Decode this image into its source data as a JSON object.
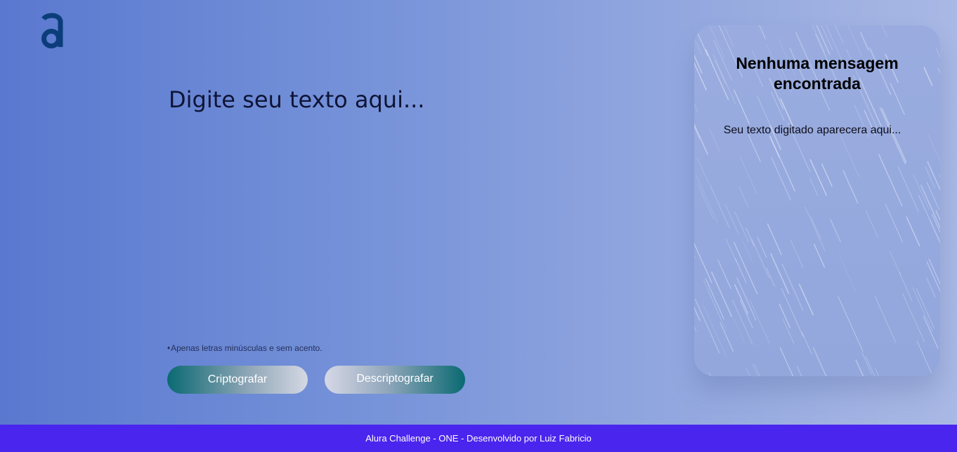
{
  "header": {
    "logo_icon": "alura-logo-icon"
  },
  "editor": {
    "placeholder": "Digite seu texto aqui..."
  },
  "hint": {
    "icon": "info-icon",
    "text": "Apenas letras minúsculas e sem acento."
  },
  "buttons": {
    "encrypt_label": "Criptografar",
    "decrypt_label": "Descriptografar"
  },
  "output_panel": {
    "title": "Nenhuma mensagem encontrada",
    "text": "Seu texto digitado aparecera aqui..."
  },
  "footer": {
    "text": "Alura Challenge - ONE - Desenvolvido por Luiz Fabricio"
  },
  "colors": {
    "footer_background": "#4a25ee",
    "logo": "#0b3d7a",
    "button_teal": "#0a6a72"
  }
}
